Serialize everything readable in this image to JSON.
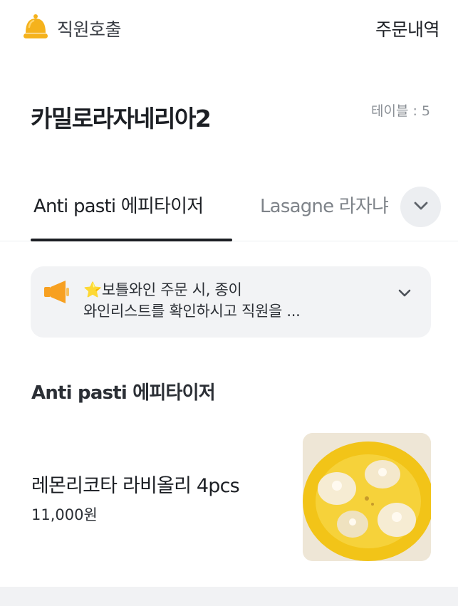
{
  "header": {
    "call_staff_label": "직원호출",
    "order_history_label": "주문내역",
    "call_icon": "bell-icon"
  },
  "store": {
    "name": "카밀로라자네리아2",
    "table_label": "테이블 : 5"
  },
  "tabs": {
    "items": [
      {
        "label": "Anti pasti 에피타이저",
        "active": true
      },
      {
        "label": "Lasagne 라자냐",
        "active": false
      }
    ],
    "expand_icon": "chevron-down-icon"
  },
  "notice": {
    "icon": "megaphone-icon",
    "line1": "⭐보틀와인 주문 시, 종이",
    "line2": "와인리스트를 확인하시고 직원을 ...",
    "expand_icon": "chevron-down-icon"
  },
  "section": {
    "title": "Anti pasti 에피타이저"
  },
  "menu_items": [
    {
      "name": "레몬리코타 라비올리 4pcs",
      "price": "11,000원",
      "image": "ravioli-photo"
    }
  ],
  "colors": {
    "bell": "#F5B21C",
    "megaphone": "#F7A021",
    "text_primary": "#1C1F24",
    "text_muted": "#8B9096",
    "notice_bg": "#F2F3F5"
  }
}
